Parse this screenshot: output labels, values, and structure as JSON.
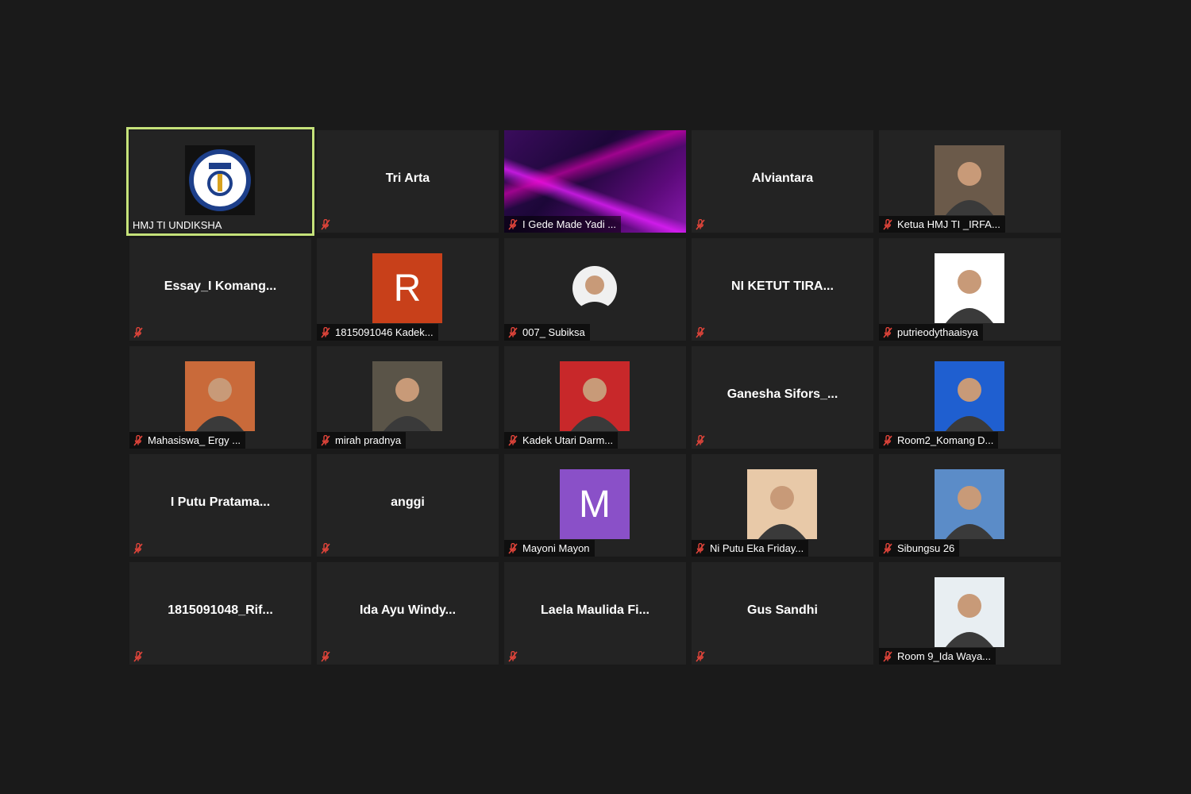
{
  "participants": [
    {
      "name": "HMJ TI UNDIKSHA",
      "kind": "logo",
      "active": true
    },
    {
      "name": "Tri Arta",
      "kind": "name"
    },
    {
      "name": "I Gede Made Yadi ...",
      "kind": "video"
    },
    {
      "name": "Alviantara",
      "kind": "name"
    },
    {
      "name": "Ketua HMJ TI _IRFA...",
      "kind": "photo",
      "photo_color": "#6b5a4a"
    },
    {
      "name": "Essay_I  Komang...",
      "kind": "name"
    },
    {
      "name": "1815091046 Kadek...",
      "kind": "letter",
      "letter": "R",
      "letter_color": "#c8401a"
    },
    {
      "name": "007_ Subiksa",
      "kind": "photo-round",
      "photo_color": "#2c2c2c"
    },
    {
      "name": "NI KETUT TIRA...",
      "kind": "name"
    },
    {
      "name": "putrieodythaaisya",
      "kind": "photo",
      "photo_color": "#ffffff"
    },
    {
      "name": "Mahasiswa_ Ergy ...",
      "kind": "photo",
      "photo_color": "#c96a3a"
    },
    {
      "name": "mirah pradnya",
      "kind": "photo",
      "photo_color": "#5a5448"
    },
    {
      "name": "Kadek Utari Darm...",
      "kind": "photo",
      "photo_color": "#c8282a"
    },
    {
      "name": "Ganesha  Sifors_...",
      "kind": "name"
    },
    {
      "name": "Room2_Komang D...",
      "kind": "photo",
      "photo_color": "#1f5fd0"
    },
    {
      "name": "I  Putu Pratama...",
      "kind": "name"
    },
    {
      "name": "anggi",
      "kind": "name"
    },
    {
      "name": "Mayoni Mayon",
      "kind": "letter",
      "letter": "M",
      "letter_color": "#8a50c8"
    },
    {
      "name": "Ni Putu Eka Friday...",
      "kind": "photo",
      "photo_color": "#e8c9a8"
    },
    {
      "name": "Sibungsu 26",
      "kind": "photo",
      "photo_color": "#5b8cc8"
    },
    {
      "name": "1815091048_Rif...",
      "kind": "name"
    },
    {
      "name": "Ida  Ayu  Windy...",
      "kind": "name"
    },
    {
      "name": "Laela  Maulida  Fi...",
      "kind": "name"
    },
    {
      "name": "Gus Sandhi",
      "kind": "name"
    },
    {
      "name": "Room 9_Ida Waya...",
      "kind": "photo",
      "photo_color": "#e8eef2"
    }
  ],
  "colors": {
    "background": "#1a1a1a",
    "tile": "#232323",
    "active_border": "#c5e27a",
    "muted_mic": "#e0443a"
  },
  "icons": {
    "muted": "mic-muted-icon"
  }
}
